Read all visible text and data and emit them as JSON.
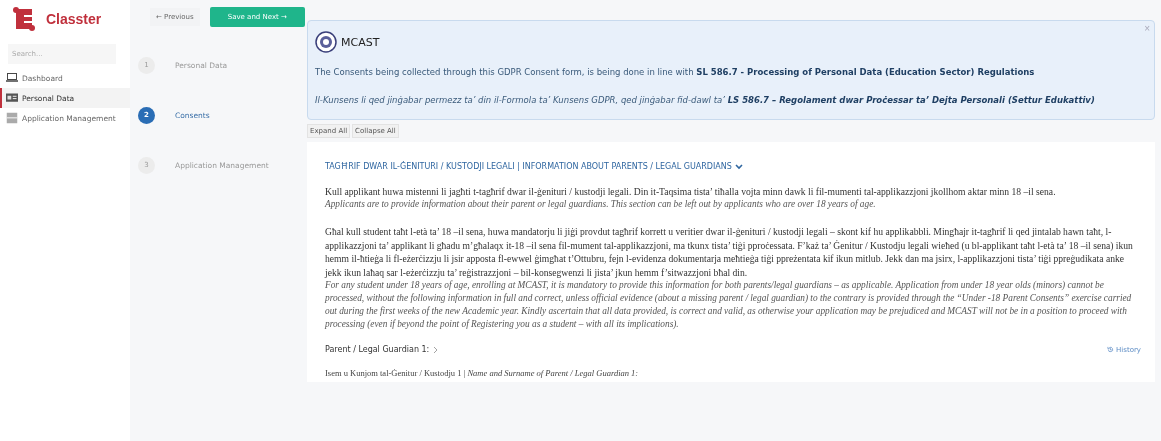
{
  "sidebar": {
    "logo_text": "Classter",
    "search": {
      "placeholder": "Search..."
    },
    "items": [
      {
        "label": "Dashboard",
        "selected": false
      },
      {
        "label": "Personal Data",
        "selected": true
      },
      {
        "label": "Application Management",
        "selected": false
      }
    ]
  },
  "toolbar": {
    "previous": "← Previous",
    "save_next": "Save and Next →"
  },
  "steps": [
    {
      "number": "1",
      "label": "Personal Data",
      "selected": false
    },
    {
      "number": "2",
      "label": "Consents",
      "selected": true
    },
    {
      "number": "3",
      "label": "Application Management",
      "selected": false
    }
  ],
  "alert": {
    "title": "MCAST",
    "close": "×",
    "text": "The Consents being collected through this GDPR Consent form, is being done in line with **SL 586.7 - Processing of Personal Data (Education Sector) Regulations**",
    "text_mt": "Il-Kunsens li qed jinġabar permezz ta’ din il-Formola ta’ Kunsens GDPR, qed jinġabar fid-dawl ta’ **LS 586.7 – Regolament dwar Proċessar ta’ Dejta Personali (Settur Edukattiv)**"
  },
  "buttons": {
    "expand_all": "Expand All",
    "collapse_all": "Collapse All"
  },
  "section": {
    "heading": "TAGĦRIF DWAR IL-ĠENITURI / KUSTODJI LEGALI | INFORMATION ABOUT PARENTS / LEGAL GUARDIANS",
    "expanded": true,
    "paragraphs": [
      {
        "kind": "mt",
        "text": "Kull applikant huwa mistenni li jagħti t-tagħrif dwar il-ġenituri / kustodji legali. Din it-Taqsima tista’ tiħalla vojta minn dawk li fil-mumenti tal-applikazzjoni jkollhom aktar minn 18 –il sena."
      },
      {
        "kind": "en",
        "text": "Applicants are to provide information about their parent or legal guardians.   This section can be left out by applicants who are over 18 years of age."
      },
      {
        "kind": "mt",
        "text": "Għal kull student taħt l-età ta’ 18 –il sena, huwa mandatorju li jiġi provdut tagħrif korrett u veritier dwar il-ġenituri / kustodji legali – skont kif hu applikabbli.  Mingħajr it-tagħrif li qed jintalab hawn taħt, l-applikazzjoni ta’ applikant li għadu m’għalaqx it-18 –il sena fil-mument tal-applikazzjoni, ma tkunx tista’ tiġi pproċessata.  F’każ ta’ Ġenitur / Kustodju legali wieħed (u bl-applikant taħt l-età ta’ 18 –il sena) ikun hemm il-ħtieġa li fl-eżerċizzju li jsir apposta fl-ewwel ġimgħat t’Ottubru, fejn l-evidenza dokumentarja meħtieġa tiġi ppreżentata kif ikun mitlub.  Jekk dan ma jsirx, l-applikazzjoni tista’ tiġi ppreġudikata anke jekk ikun laħaq sar l-eżerċizzju ta’ reġistrazzjoni – bil-konsegwenzi li jista’ jkun hemm f’sitwazzjoni bħal din."
      },
      {
        "kind": "en",
        "text": "For any student under 18 years of age, enrolling at MCAST, it is mandatory to provide this information for both parents/legal guardians – as applicable.   Application from under 18 year olds (minors) cannot be processed, without the following information in full and correct, unless official evidence (about a missing parent / legal guardian) to the contrary is provided through the “Under -18 Parent Consents” exercise carried out during the first weeks of the new Academic year.   Kindly ascertain that all data provided, is correct and valid, as otherwise your application may be prejudiced and MCAST will not be in a position to proceed with processing (even if beyond the point of Registering you as a student – with all its implications)."
      }
    ],
    "guardian": {
      "title": "Parent / Legal Guardian 1:",
      "expanded": false,
      "history": "History",
      "field_label": "Isem u Kunjom tal-Ġenitur / Kustodju 1 | *Name and Surname of Parent / Legal Guardian 1:*"
    }
  }
}
